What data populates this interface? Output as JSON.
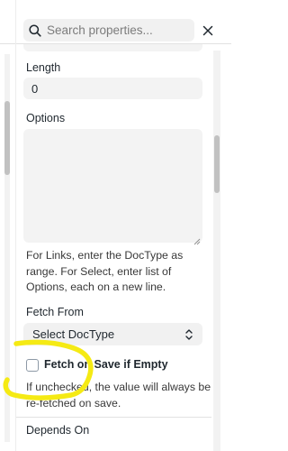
{
  "search": {
    "placeholder": "Search properties..."
  },
  "icons": {
    "search": "search-icon",
    "close": "close-icon",
    "select_arrows": "chevron-up-down-icon"
  },
  "fields": {
    "length": {
      "label": "Length",
      "value": "0"
    },
    "options": {
      "label": "Options",
      "value": "",
      "help": "For Links, enter the DocType as range. For Select, enter list of Options, each on a new line."
    },
    "fetch_from": {
      "label": "Fetch From",
      "selected": "Select DocType"
    },
    "fetch_if_empty": {
      "label": "Fetch on Save if Empty",
      "checked": false,
      "help": "If unchecked, the value will always be re-fetched on save."
    },
    "depends_on": {
      "label": "Depends On"
    }
  },
  "colors": {
    "annotation": "#f5ea14",
    "input_bg": "#f3f3f3",
    "text": "#1f272e"
  }
}
